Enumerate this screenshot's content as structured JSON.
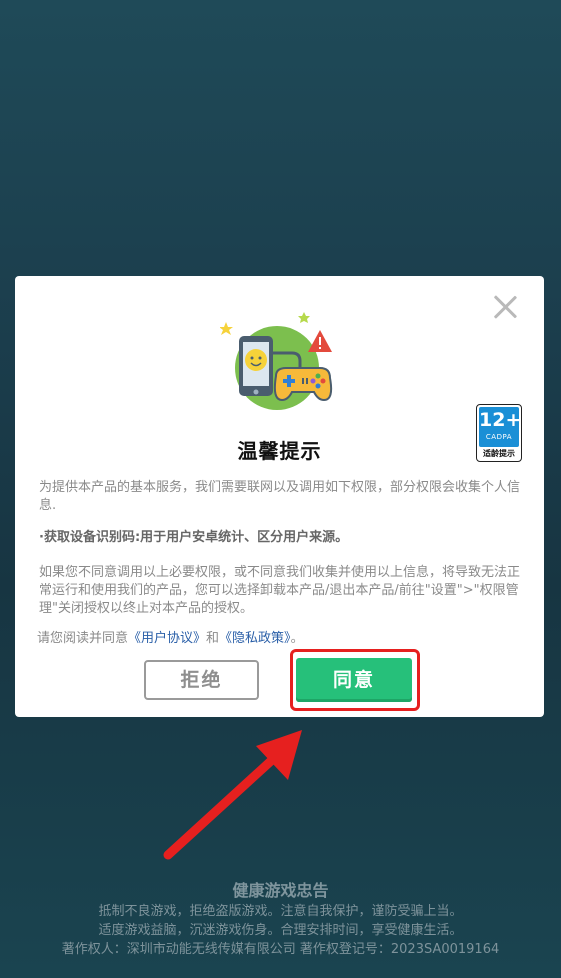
{
  "dialog": {
    "close_icon": "close-icon",
    "badge": {
      "number": "12+",
      "org": "CADPA",
      "label": "适龄提示"
    },
    "title": "温馨提示",
    "para1": "为提供本产品的基本服务，我们需要联网以及调用如下权限，部分权限会收集个人信息.",
    "para2": "·获取设备识别码:用于用户安卓统计、区分用户来源。",
    "para3": "如果您不同意调用以上必要权限，或不同意我们收集并使用以上信息，将导致无法正常运行和使用我们的产品，您可以选择卸载本产品/退出本产品/前往\"设置\">\"权限管理\"关闭授权以终止对本产品的授权。",
    "consent_prefix": "请您阅读并同意",
    "user_agreement": "《用户协议》",
    "consent_and": "和",
    "privacy_policy": "《隐私政策》",
    "consent_suffix": "。",
    "reject_label": "拒绝",
    "agree_label": "同意"
  },
  "footer": {
    "title": "健康游戏忠告",
    "line1": "抵制不良游戏，拒绝盗版游戏。注意自我保护，谨防受骗上当。",
    "line2": "适度游戏益脑，沉迷游戏伤身。合理安排时间，享受健康生活。",
    "line3": "著作权人：深圳市动能无线传媒有限公司    著作权登记号：2023SA0019164"
  },
  "colors": {
    "agree": "#26c07a",
    "highlight": "#e6201f",
    "link": "#2a5fa8",
    "badge_blue": "#1a8fd6"
  }
}
